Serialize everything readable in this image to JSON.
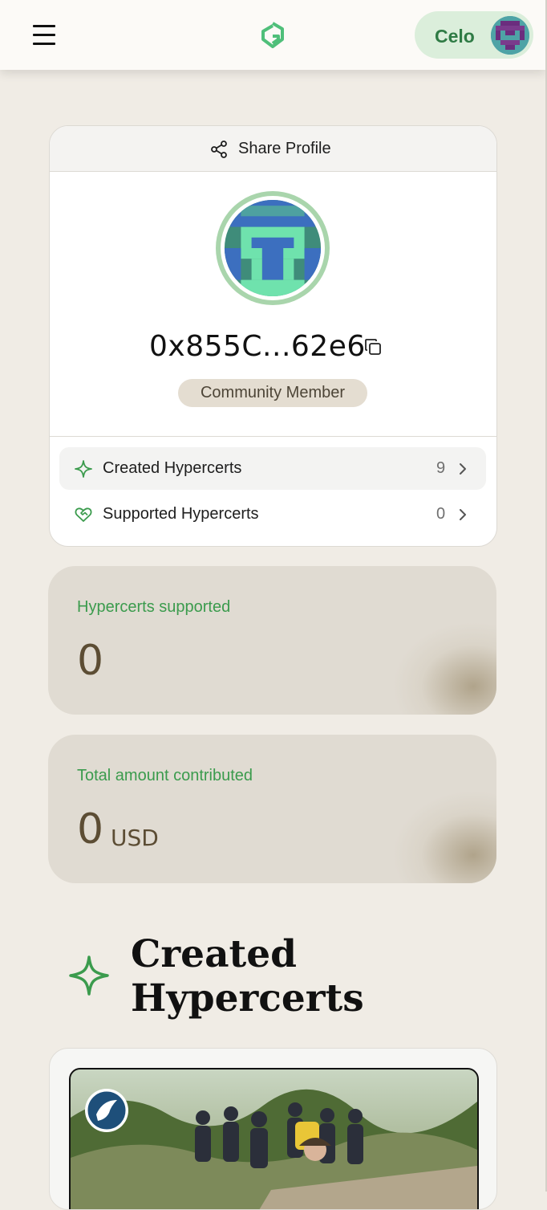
{
  "header": {
    "menu_icon": "hamburger-menu-icon",
    "logo_icon": "app-logo-icon",
    "network": "Celo",
    "brand_color": "#2f7b45"
  },
  "profile": {
    "share_label": "Share Profile",
    "address": "0x855C...62e6",
    "role_badge": "Community Member"
  },
  "menu": [
    {
      "label": "Created Hypercerts",
      "count": "9",
      "icon": "sparkle-icon"
    },
    {
      "label": "Supported Hypercerts",
      "count": "0",
      "icon": "heart-handshake-icon"
    }
  ],
  "stats": {
    "supported": {
      "label": "Hypercerts supported",
      "value": "0"
    },
    "contributed": {
      "label": "Total amount contributed",
      "value": "0",
      "unit": "USD"
    }
  },
  "section": {
    "title": "Created Hypercerts"
  },
  "colors": {
    "accent_green": "#3b9b4d",
    "background": "#f0ece5",
    "stat_card": "#e0dbd2"
  }
}
